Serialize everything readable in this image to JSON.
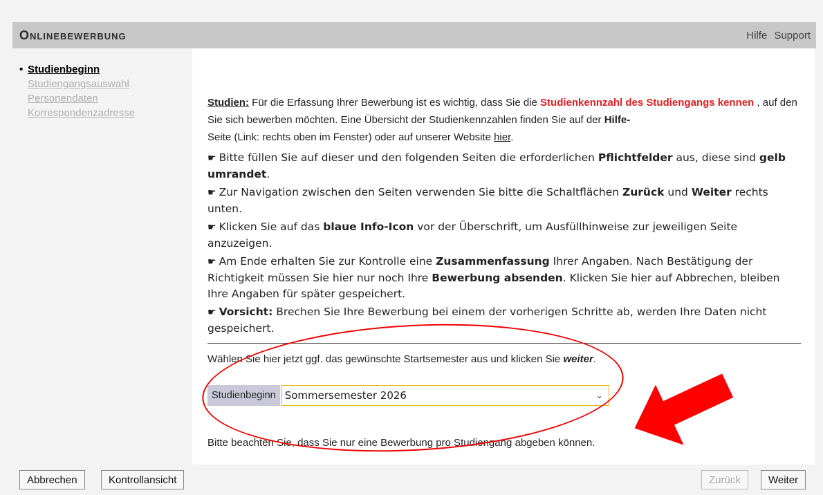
{
  "header": {
    "title": "Onlinebewerbung",
    "help": "Hilfe",
    "support": "Support"
  },
  "sidebar": {
    "items": [
      {
        "label": "Studienbeginn"
      },
      {
        "label": "Studiengangsauswahl"
      },
      {
        "label": "Personendaten"
      },
      {
        "label": "Korrespondenzadresse"
      }
    ]
  },
  "intro": {
    "lead": "Studien:",
    "t1": " Für die Erfassung Ihrer Bewerbung ist es wichtig, dass Sie die ",
    "red": "Studienkennzahl des Studiengangs kennen",
    "t2": " , auf den Sie sich bewerben möchten. Eine Übersicht der Studienkennzahlen finden Sie auf der ",
    "help_bold": "Hilfe-",
    "t3": "Seite (Link: rechts oben im Fenster) oder auf unserer Website ",
    "link": "hier",
    "t4": "."
  },
  "bullets": [
    {
      "a": "Bitte füllen Sie auf dieser und den folgenden Seiten die erforderlichen ",
      "b1": "Pflichtfelder",
      "c": " aus, diese sind ",
      "b2": "gelb umrandet",
      "d": "."
    },
    {
      "a": "Zur Navigation zwischen den Seiten verwenden Sie bitte die Schaltflächen ",
      "b1": "Zurück",
      "c": " und ",
      "b2": "Weiter",
      "d": " rechts unten."
    },
    {
      "a": "Klicken Sie auf das ",
      "b1": "blaue Info-Icon",
      "c": " vor der Überschrift, um Ausfüllhinweise zur jeweiligen Seite anzuzeigen.",
      "b2": "",
      "d": ""
    },
    {
      "a": "Am Ende erhalten Sie zur Kontrolle eine ",
      "b1": "Zusammenfassung",
      "c": " Ihrer Angaben. Nach Bestätigung der Richtigkeit müssen Sie hier nur noch Ihre ",
      "b2": "Bewerbung absenden",
      "d": ". Klicken Sie hier auf Abbrechen, bleiben Ihre Angaben für später gespeichert."
    },
    {
      "a": "",
      "b1": "Vorsicht:",
      "c": " Brechen Sie Ihre Bewerbung bei einem der vorherigen Schritte ab, werden Ihre Daten nicht gespeichert.",
      "b2": "",
      "d": ""
    }
  ],
  "choose": {
    "text": "Wählen Sie hier jetzt ggf. das gewünschte Startsemester aus und klicken Sie ",
    "em": "weiter",
    "end": "."
  },
  "select": {
    "label": "Studienbeginn",
    "value": "Sommersemester 2026"
  },
  "note": "Bitte beachten Sie, dass Sie nur eine Bewerbung pro Studiengang abgeben können.",
  "buttons": {
    "cancel": "Abbrechen",
    "review": "Kontrollansicht",
    "back": "Zurück",
    "next": "Weiter"
  },
  "colors": {
    "annotation": "#e00000",
    "required_border": "#e6b800",
    "label_bg": "#c9c9da"
  }
}
